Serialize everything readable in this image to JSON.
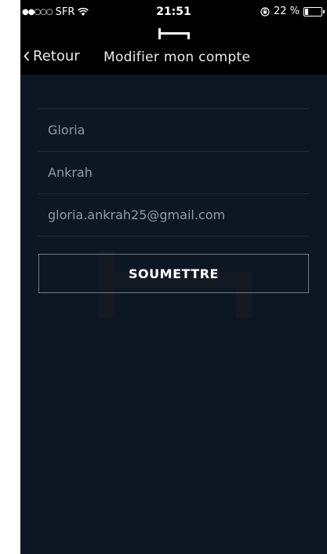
{
  "status_bar": {
    "carrier": "SFR",
    "time": "21:51",
    "battery_percent": "22 %",
    "battery_level": 0.22
  },
  "nav": {
    "back_label": "Retour",
    "title": "Modifier mon compte"
  },
  "form": {
    "first_name": "Gloria",
    "last_name": "Ankrah",
    "email": "gloria.ankrah25@gmail.com"
  },
  "submit_label": "SOUMETTRE",
  "colors": {
    "background": "#0d1623",
    "bar": "#000000",
    "field_text": "#8f9bab",
    "divider": "#1f2a38",
    "button_border": "#6e7a8a"
  }
}
